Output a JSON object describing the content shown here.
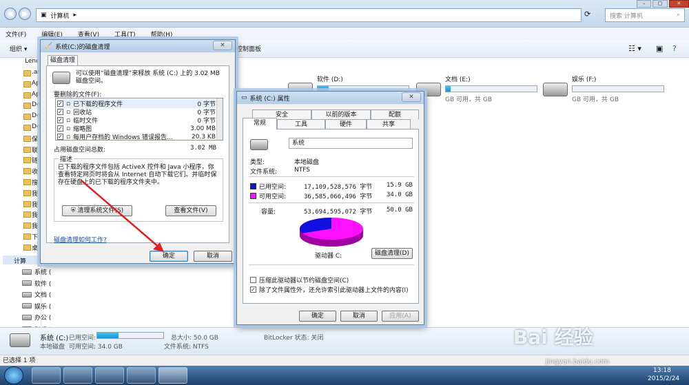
{
  "explorer": {
    "address": "计算机",
    "search_placeholder": "搜索 计算机",
    "menu": [
      "文件(F)",
      "编辑(E)",
      "查看(V)",
      "工具(T)",
      "帮助(H)"
    ],
    "organize": "组织",
    "control_panel": "打开控制面板",
    "sidebar_top": [
      "Lenc",
      ".an",
      "Ap",
      "Ap",
      "De",
      "De",
      "De",
      "保",
      "联",
      "链",
      "收",
      "搜",
      "我",
      "我",
      "我",
      "我",
      "下",
      "桌"
    ],
    "sidebar_computer": "计算",
    "sidebar_lower": [
      "系统 (C:)",
      "软件 (D:)",
      "文档 (E:)",
      "娱乐 (F:)",
      "办公 (G:)",
      "DVD RW 驱动器 (I:)"
    ],
    "drives": [
      {
        "name": "软件 (D:)",
        "space": "",
        "fill": 0.12
      },
      {
        "name": "文档 (E:)",
        "space": "GB 可用，共    GB",
        "fill": 0.05
      },
      {
        "name": "娱乐 (F:)",
        "space": "GB 可用，共    GB",
        "fill": 0.0
      }
    ],
    "details": {
      "name": "系统 (C:)",
      "used_label": "已用空间:",
      "free_label": "可用空间: 34.0 GB",
      "type": "本地磁盘",
      "total": "总大小: 50.0 GB",
      "fs": "文件系统: NTFS",
      "bitlocker": "BitLocker 状态: 关闭",
      "used_fill": 0.32
    },
    "status": "已选择 1 项",
    "clock_time": "13:18",
    "clock_date": "2015/2/24",
    "watermark": "Bai 经验",
    "watermark_url": "jingyan.baidu.com"
  },
  "cleanup": {
    "title": "系统(C:)的磁盘清理",
    "tab": "磁盘清理",
    "intro": "可以使用“磁盘清理”来释放 系统 (C:) 上的 3.02 MB 磁盘空间。",
    "files_label": "要删除的文件(F):",
    "files": [
      {
        "name": "已下载的程序文件",
        "size": "0 字节",
        "checked": true
      },
      {
        "name": "回收站",
        "size": "0 字节",
        "checked": true
      },
      {
        "name": "临时文件",
        "size": "0 字节",
        "checked": true
      },
      {
        "name": "缩略图",
        "size": "3.00 MB",
        "checked": true
      },
      {
        "name": "每用户存档的 Windows 错误报告...",
        "size": "20.3 KB",
        "checked": true
      }
    ],
    "total_label": "占用磁盘空间总数:",
    "total_value": "3.02 MB",
    "desc_label": "描述",
    "desc": "已下载的程序文件包括 ActiveX 控件和 Java 小程序，你查看特定网页时将会从 Internet 自动下载它们。并临时保存在硬盘上的已下载的程序文件夹中。",
    "clean_system": "清理系统文件(S)",
    "view_files": "查看文件(V)",
    "how_link": "磁盘清理如何工作?",
    "ok": "确定",
    "cancel": "取消"
  },
  "props": {
    "title": "系统 (C:) 属性",
    "tabs_row1": [
      "安全",
      "以前的版本",
      "配额"
    ],
    "tabs_row2": [
      "常规",
      "工具",
      "硬件",
      "共享"
    ],
    "name_value": "系统",
    "type_label": "类型:",
    "type_value": "本地磁盘",
    "fs_label": "文件系统:",
    "fs_value": "NTFS",
    "used_label": "已用空间:",
    "used_bytes": "17,109,528,576 字节",
    "used_gb": "15.9 GB",
    "free_label": "可用空间:",
    "free_bytes": "36,585,066,496 字节",
    "free_gb": "34.0 GB",
    "cap_label": "容量:",
    "cap_bytes": "53,694,595,072 字节",
    "cap_gb": "50.0 GB",
    "drive_label": "驱动器 C:",
    "cleanup_btn": "磁盘清理(D)",
    "compress": "压缩此驱动器以节约磁盘空间(C)",
    "index": "除了文件属性外，还允许索引此驱动器上文件的内容(I)",
    "ok": "确定",
    "cancel": "取消",
    "apply": "应用(A)",
    "used_color": "#1010e0",
    "free_color": "#ff10ff",
    "used_fraction": 0.318
  }
}
